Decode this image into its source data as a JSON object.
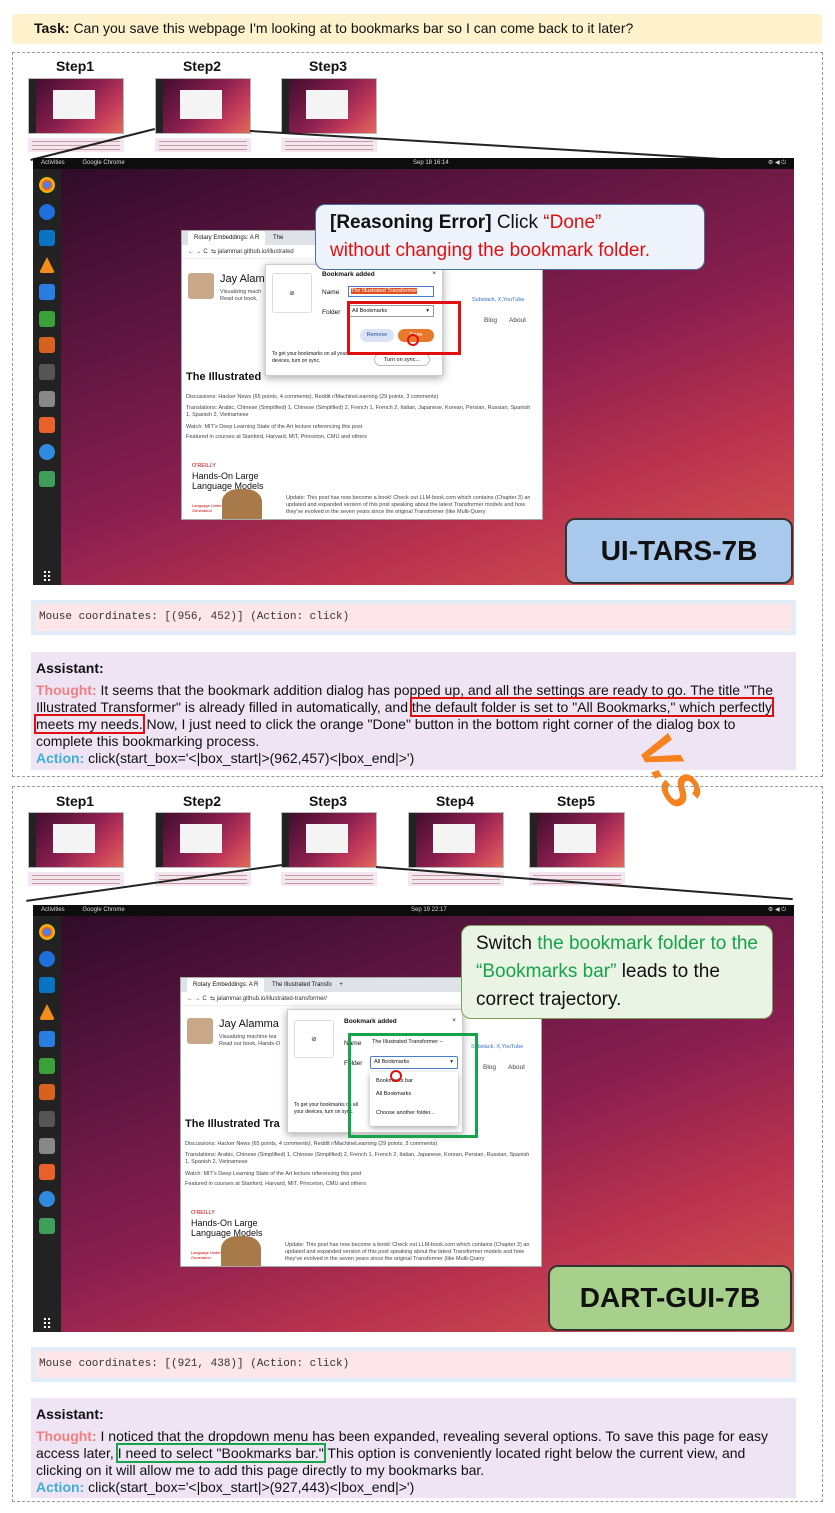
{
  "task": {
    "label": "Task:",
    "text": "Can you save this webpage I'm looking at to bookmarks bar so I can come back to it later?"
  },
  "vs_label": "V.S",
  "colors": {
    "orange": "#f5821f",
    "red": "#e01010",
    "green": "#16a34a",
    "blue_badge": "#a8c8ec",
    "green_badge": "#a8d08d"
  },
  "panel1": {
    "steps": [
      "Step1",
      "Step2",
      "Step3"
    ],
    "screen": {
      "activities": "Activities",
      "app": "Google Chrome",
      "clock": "Sep 18  16:14",
      "tab1": "Rotary Embeddings: A R",
      "tab2": "The",
      "url": "jalammar.github.io/illustrated",
      "author": "Jay Alam",
      "tagline1": "Visualizing mach",
      "tagline2": "Read our book,",
      "links": "Substack, X,YouTube",
      "nav_blog": "Blog",
      "nav_about": "About",
      "page_title": "The Illustrated",
      "discussions": "Discussions: Hacker News (65 points, 4 comments), Reddit r/MachineLearning (29 points, 3 comments)",
      "translations": "Translations: Arabic, Chinese (Simplified) 1, Chinese (Simplified) 2, French 1, French 2, Italian, Japanese, Korean, Persian, Russian, Spanish 1, Spanish 2, Vietnamese",
      "watch": "Watch: MIT's Deep Learning State of the Art lecture referencing this post",
      "featured": "Featured in courses at Stanford, Harvard, MIT, Princeton, CMU and others",
      "book_publisher": "O'REILLY",
      "book_title": "Hands-On Large Language Models",
      "book_sub": "Language Understanding and Generation",
      "update": "Update: This post has now become a book! Check out LLM-book.com which contains (Chapter 3) an updated and expanded version of this post speaking about the latest Transformer models and how they've evolved in the seven years since the original Transformer (like Multi-Query"
    },
    "dialog": {
      "title": "Bookmark added",
      "name_label": "Name",
      "name_value": "The Illustrated Transformer",
      "folder_label": "Folder",
      "folder_value": "All Bookmarks",
      "remove": "Remove",
      "done": "Done",
      "sync_text": "To get your bookmarks on all your devices, turn on sync.",
      "sync_button": "Turn on sync..."
    },
    "callout": {
      "tag": "[Reasoning Error]",
      "click": "Click",
      "done": "“Done”",
      "rest": "without changing the bookmark folder."
    },
    "model": "UI-TARS-7B",
    "mouse": "Mouse coordinates: [(956, 452)] (Action: click)",
    "assistant": {
      "heading": "Assistant:",
      "thought_label": "Thought:",
      "thought_a": "It seems that the bookmark addition dialog has popped up, and all the settings are ready to go. The title \"The Illustrated Transformer\" is already filled in automatically, and",
      "thought_hl": "the default folder is set to \"All Bookmarks,\" which perfectly meets my needs.",
      "thought_b": "Now, I just need to click the orange \"Done\" button in the bottom right corner of the dialog box to complete this bookmarking process.",
      "action_label": "Action:",
      "action": "click(start_box='<|box_start|>(962,457)<|box_end|>')"
    }
  },
  "panel2": {
    "steps": [
      "Step1",
      "Step2",
      "Step3",
      "Step4",
      "Step5"
    ],
    "screen": {
      "activities": "Activities",
      "app": "Google Chrome",
      "clock": "Sep 19  22:17",
      "tab1": "Rotary Embeddings: A R",
      "tab2": "The Illustrated Transfo",
      "url": "jalammar.github.io/illustrated-transformer/",
      "author": "Jay Alamma",
      "tagline1": "Visualizing machine lea",
      "tagline2": "Read our book, Hands-O",
      "links": "Subslack, X,YouTube",
      "nav_blog": "Blog",
      "nav_about": "About",
      "page_title": "The Illustrated Tra",
      "discussions": "Discussions: Hacker News (65 points, 4 comments), Reddit r/MachineLearning (29 points, 3 comments)",
      "translations": "Translations: Arabic, Chinese (Simplified) 1, Chinese (Simplified) 2, French 1, French 2, Italian, Japanese, Korean, Persian, Russian, Spanish 1, Spanish 2, Vietnamese",
      "watch": "Watch: MIT's Deep Learning State of the Art lecture referencing this post",
      "featured": "Featured in courses at Stanford, Harvard, MIT, Princeton, CMU and others",
      "book_publisher": "O'REILLY",
      "book_title": "Hands-On Large Language Models",
      "book_sub": "Language Understanding and Generation",
      "update": "Update: This post has now become a book! Check out LLM-book.com which contains (Chapter 3) an updated and expanded version of this post speaking about the latest Transformer models and how they've evolved in the seven years since the original Transformer (like Multi-Query"
    },
    "dialog": {
      "title": "Bookmark added",
      "name_label": "Name",
      "name_value": "The Illustrated Transformer –",
      "folder_label": "Folder",
      "folder_value": "All Bookmarks",
      "options": [
        "Bookmarks bar",
        "All Bookmarks",
        "Choose another folder..."
      ],
      "sync_text": "To get your bookmarks on all your devices, turn on sync."
    },
    "callout": {
      "switch": "Switch",
      "green": "the bookmark folder to the “Bookmarks bar”",
      "rest": "leads to the correct trajectory."
    },
    "model": "DART-GUI-7B",
    "mouse": "Mouse coordinates: [(921, 438)] (Action: click)",
    "assistant": {
      "heading": "Assistant:",
      "thought_label": "Thought:",
      "thought_a": "I noticed that the dropdown menu has been expanded, revealing several options. To save this page for easy access later,",
      "thought_hl": "I need to select \"Bookmarks bar.\"",
      "thought_b": "This option is conveniently located right below the current view, and clicking on it will allow me to add this page directly to my bookmarks bar.",
      "action_label": "Action:",
      "action": "click(start_box='<|box_start|>(927,443)<|box_end|>')"
    }
  }
}
